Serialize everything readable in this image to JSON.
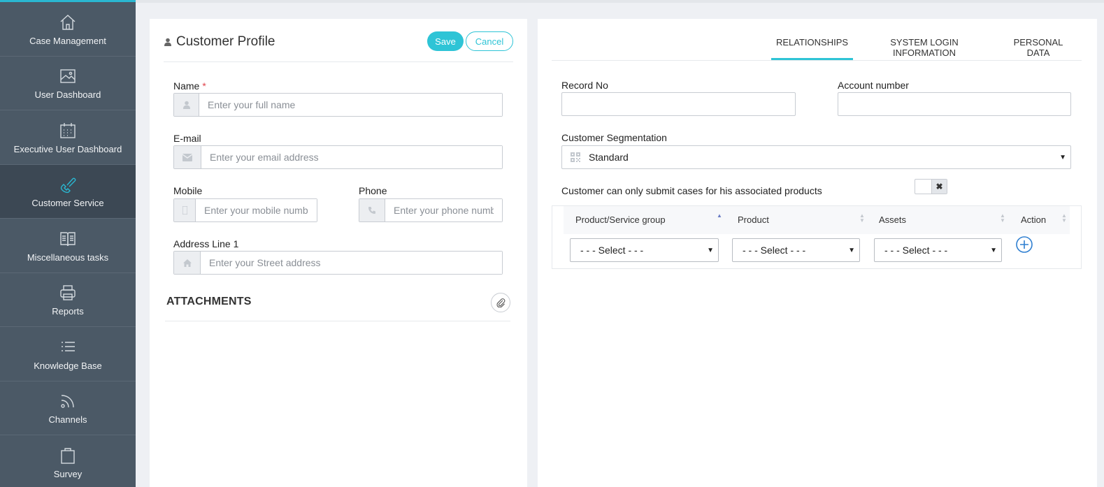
{
  "sidebar": {
    "items": [
      {
        "label": "Case Management",
        "icon": "home-icon"
      },
      {
        "label": "User Dashboard",
        "icon": "image-icon"
      },
      {
        "label": "Executive User Dashboard",
        "icon": "calendar-icon"
      },
      {
        "label": "Customer Service",
        "icon": "phone-icon",
        "active": true
      },
      {
        "label": "Miscellaneous tasks",
        "icon": "book-icon"
      },
      {
        "label": "Reports",
        "icon": "printer-icon"
      },
      {
        "label": "Knowledge Base",
        "icon": "list-icon"
      },
      {
        "label": "Channels",
        "icon": "rss-icon"
      },
      {
        "label": "Survey",
        "icon": "clipboard-icon"
      }
    ]
  },
  "profile": {
    "title": "Customer Profile",
    "save_label": "Save",
    "cancel_label": "Cancel",
    "name_label": "Name",
    "name_required": "*",
    "name_placeholder": "Enter your full name",
    "email_label": "E-mail",
    "email_placeholder": "Enter your email address",
    "mobile_label": "Mobile",
    "mobile_placeholder": "Enter your mobile number",
    "phone_label": "Phone",
    "phone_placeholder": "Enter your phone number",
    "address_label": "Address Line 1",
    "address_placeholder": "Enter your Street address",
    "attachments_title": "ATTACHMENTS"
  },
  "tabs": [
    {
      "label": "RELATIONSHIPS",
      "active": true
    },
    {
      "label": "SYSTEM LOGIN INFORMATION"
    },
    {
      "label": "PERSONAL DATA"
    }
  ],
  "relationships": {
    "record_no_label": "Record No",
    "account_number_label": "Account number",
    "segmentation_label": "Customer Segmentation",
    "segmentation_value": "Standard",
    "assoc_label": "Customer can only submit cases for his associated products",
    "assoc_toggle_icon": "✖",
    "table": {
      "headers": [
        "Product/Service group",
        "Product",
        "Assets",
        "Action"
      ],
      "selects": [
        "- - - Select - - -",
        "- - - Select - - -",
        "- - - Select - - -"
      ]
    }
  },
  "colors": {
    "accent": "#2ec4d6",
    "sidebar_bg": "#4b5966",
    "sidebar_active_bg": "#3c4854"
  }
}
